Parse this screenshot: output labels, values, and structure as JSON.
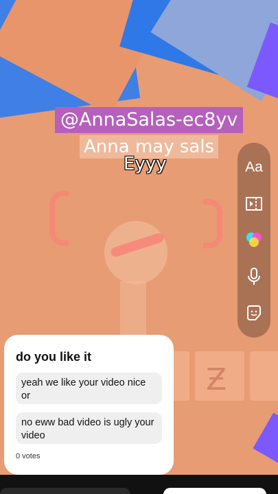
{
  "story": {
    "mention_sticker": "@AnnaSalas-ec8yv",
    "caption": "Anna may sals",
    "greeting": "Eyyy"
  },
  "tools": [
    {
      "name": "text-tool",
      "label": "Aa",
      "icon": "text-icon"
    },
    {
      "name": "media-tool",
      "icon": "media-frame-icon"
    },
    {
      "name": "color-tool",
      "icon": "color-circles-icon"
    },
    {
      "name": "voice-tool",
      "icon": "microphone-icon"
    },
    {
      "name": "sticker-tool",
      "icon": "sticker-icon"
    }
  ],
  "poll": {
    "question": "do you like it",
    "options": [
      "yeah we like your video nice or",
      "no eww bad video is ugly your video"
    ],
    "votes": "0 votes"
  },
  "colors": {
    "background": "#e79c73",
    "mention_bg": "#b65fbd",
    "rail_bg": "#785040"
  }
}
